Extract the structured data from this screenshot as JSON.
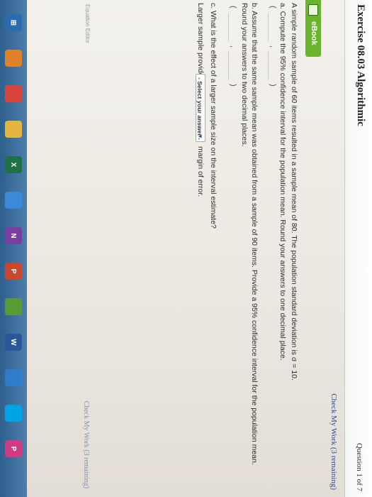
{
  "header": {
    "exercise_title": "Exercise 08.03 Algorithmic",
    "question_label": "Question 1 of 7"
  },
  "check_work": {
    "top_label": "Check My Work (3 remaining)",
    "bottom_label": "Check My Work (3 remaining)"
  },
  "ebook": {
    "label": "eBook"
  },
  "problem": {
    "intro": "A simple random sample of 60 items resulted in a sample mean of 80. The population standard deviation is σ = 10.",
    "part_a": "a. Compute the 95% confidence interval for the population mean. Round your answers to one decimal place.",
    "part_b_line1": "b. Assume that the same sample mean was obtained from a sample of 90 items. Provide a 95% confidence interval for the population mean.",
    "part_b_line2": "Round your answers to two decimal places.",
    "part_c_line1": "c. What is the effect of a larger sample size on the interval estimate?",
    "part_c_prefix": "Larger sample provides a",
    "part_c_suffix": "margin of error.",
    "select_value": "- Select your answer -"
  },
  "footer": {
    "equation_editor": "Equation Editor"
  },
  "taskbar": {
    "icons": [
      {
        "name": "windows-start-icon",
        "color": "#2b6cb0",
        "glyph": "⊞"
      },
      {
        "name": "firefox-icon",
        "color": "#e0822a",
        "glyph": ""
      },
      {
        "name": "chrome-icon",
        "color": "#d9453b",
        "glyph": ""
      },
      {
        "name": "folder-icon",
        "color": "#e4b640",
        "glyph": ""
      },
      {
        "name": "excel-icon",
        "color": "#1e7145",
        "glyph": "X"
      },
      {
        "name": "store-icon",
        "color": "#3b8ad9",
        "glyph": ""
      },
      {
        "name": "onenote-icon",
        "color": "#7a3ea1",
        "glyph": "N"
      },
      {
        "name": "powerpoint-icon",
        "color": "#c9482b",
        "glyph": "P"
      },
      {
        "name": "media-icon",
        "color": "#5a9a35",
        "glyph": ""
      },
      {
        "name": "word-icon",
        "color": "#2b579a",
        "glyph": "W"
      },
      {
        "name": "mail-icon",
        "color": "#2f7dc9",
        "glyph": ""
      },
      {
        "name": "skype-icon",
        "color": "#00a4e4",
        "glyph": ""
      },
      {
        "name": "app-icon",
        "color": "#d23a83",
        "glyph": "P"
      }
    ]
  }
}
